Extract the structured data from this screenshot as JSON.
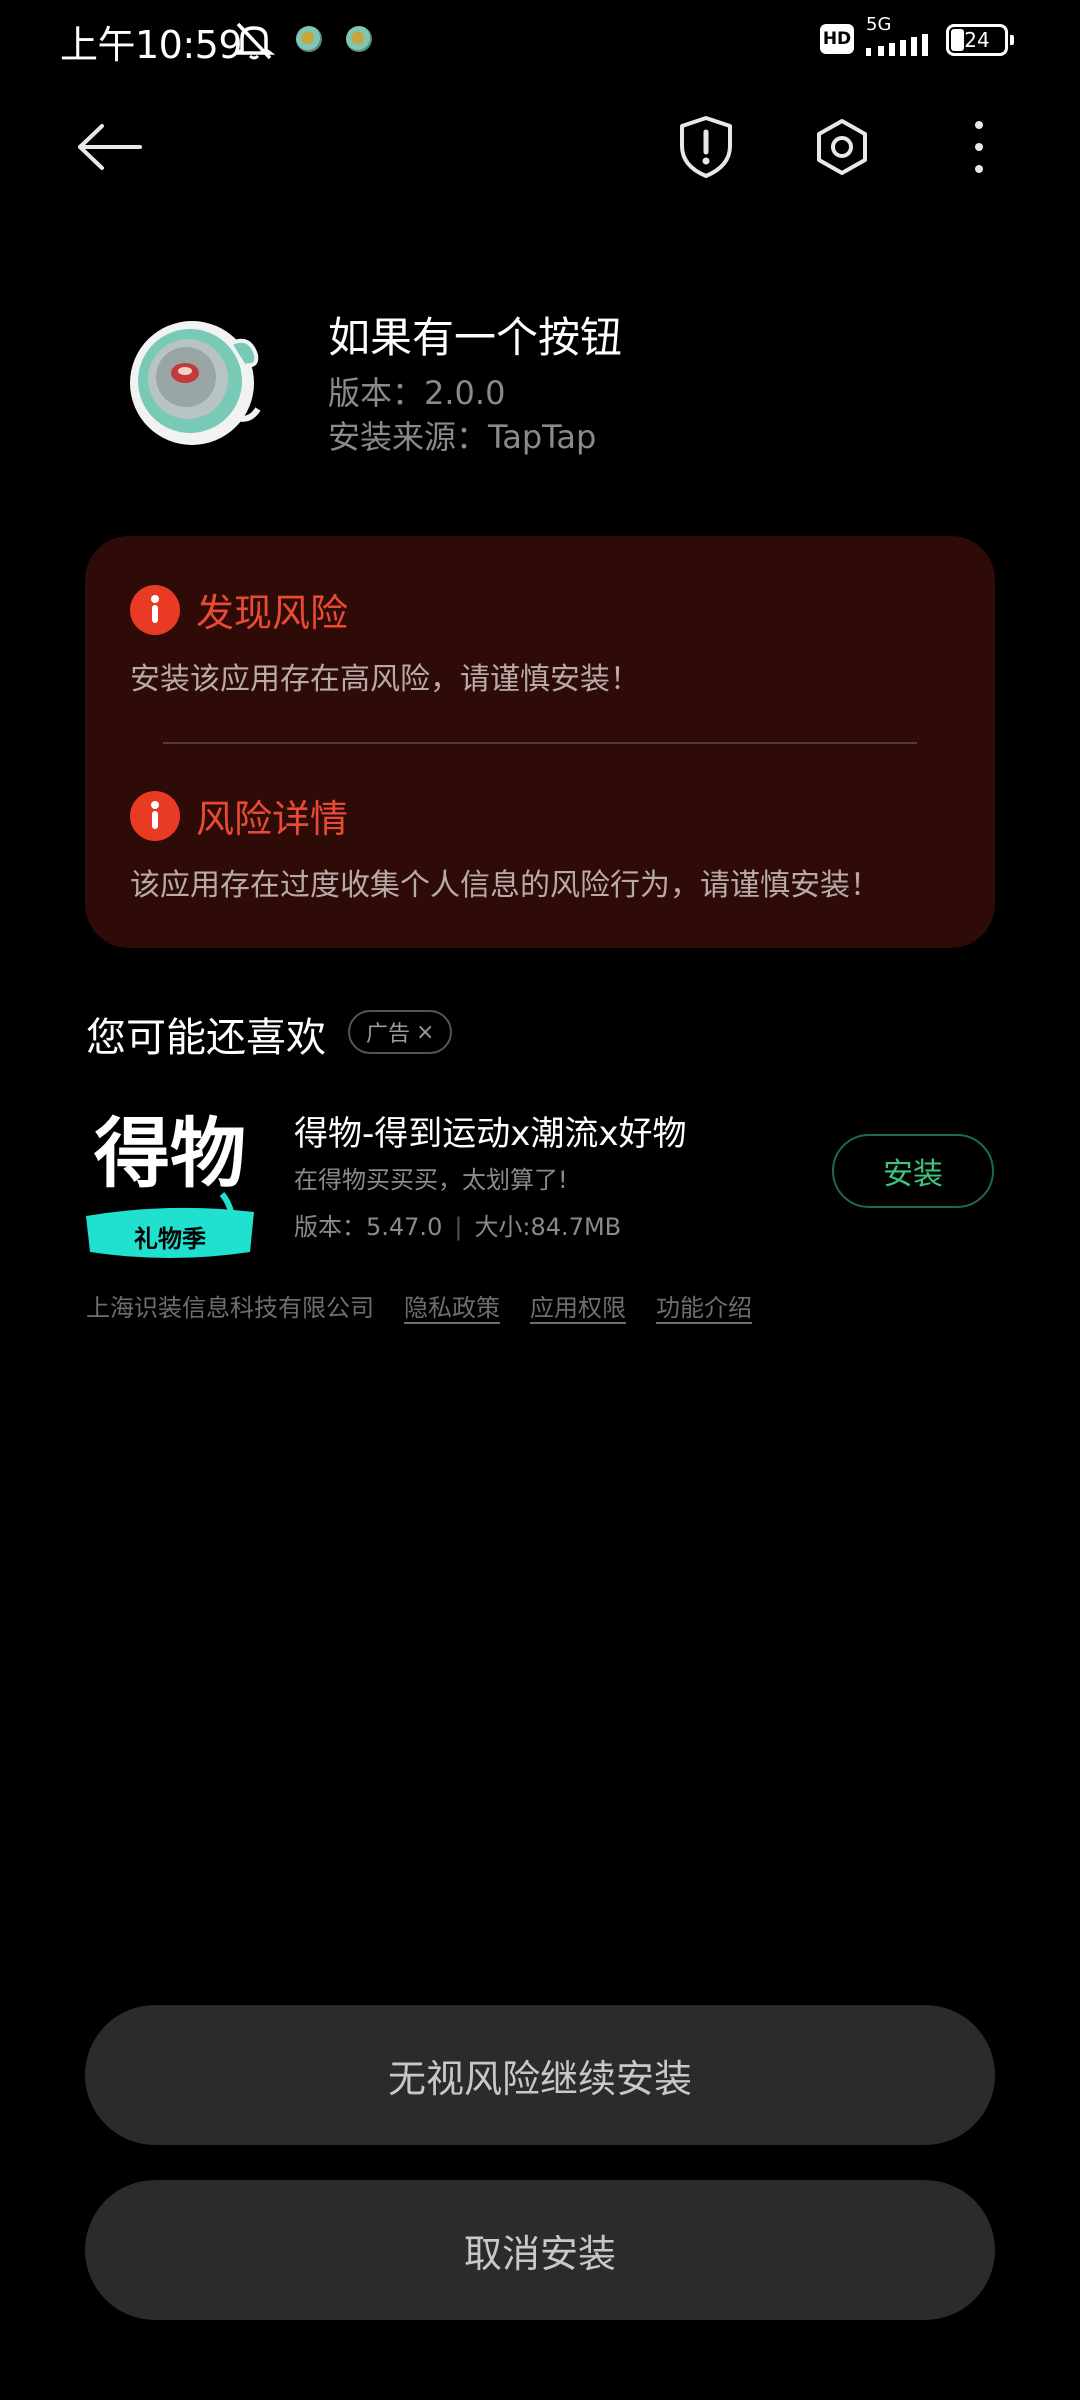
{
  "status_bar": {
    "time": "上午10:59",
    "hd": "HD",
    "network": "5G",
    "battery": "24"
  },
  "app": {
    "name": "如果有一个按钮",
    "version": "版本：2.0.0",
    "source": "安装来源：TapTap"
  },
  "risk": {
    "found_title": "发现风险",
    "found_desc": "安装该应用存在高风险，请谨慎安装！",
    "detail_title": "风险详情",
    "detail_desc": "该应用存在过度收集个人信息的风险行为，请谨慎安装！"
  },
  "recommend": {
    "heading": "您可能还喜欢",
    "ad_label": "广告",
    "ad_close": "×",
    "item": {
      "icon_text": "得物",
      "icon_subtext": "礼物季",
      "title": "得物-得到运动x潮流x好物",
      "slogan": "在得物买买买，太划算了!",
      "version": "版本：5.47.0",
      "size": "大小:84.7MB",
      "install_label": "安装",
      "company": "上海识装信息科技有限公司",
      "privacy": "隐私政策",
      "permissions": "应用权限",
      "features": "功能介绍"
    }
  },
  "actions": {
    "continue_label": "无视风险继续安装",
    "cancel_label": "取消安装"
  },
  "colors": {
    "risk_red": "#e84a35",
    "card_bg": "#2e0b07",
    "install_green": "#3ec47e",
    "button_bg": "#2b2b2b"
  }
}
